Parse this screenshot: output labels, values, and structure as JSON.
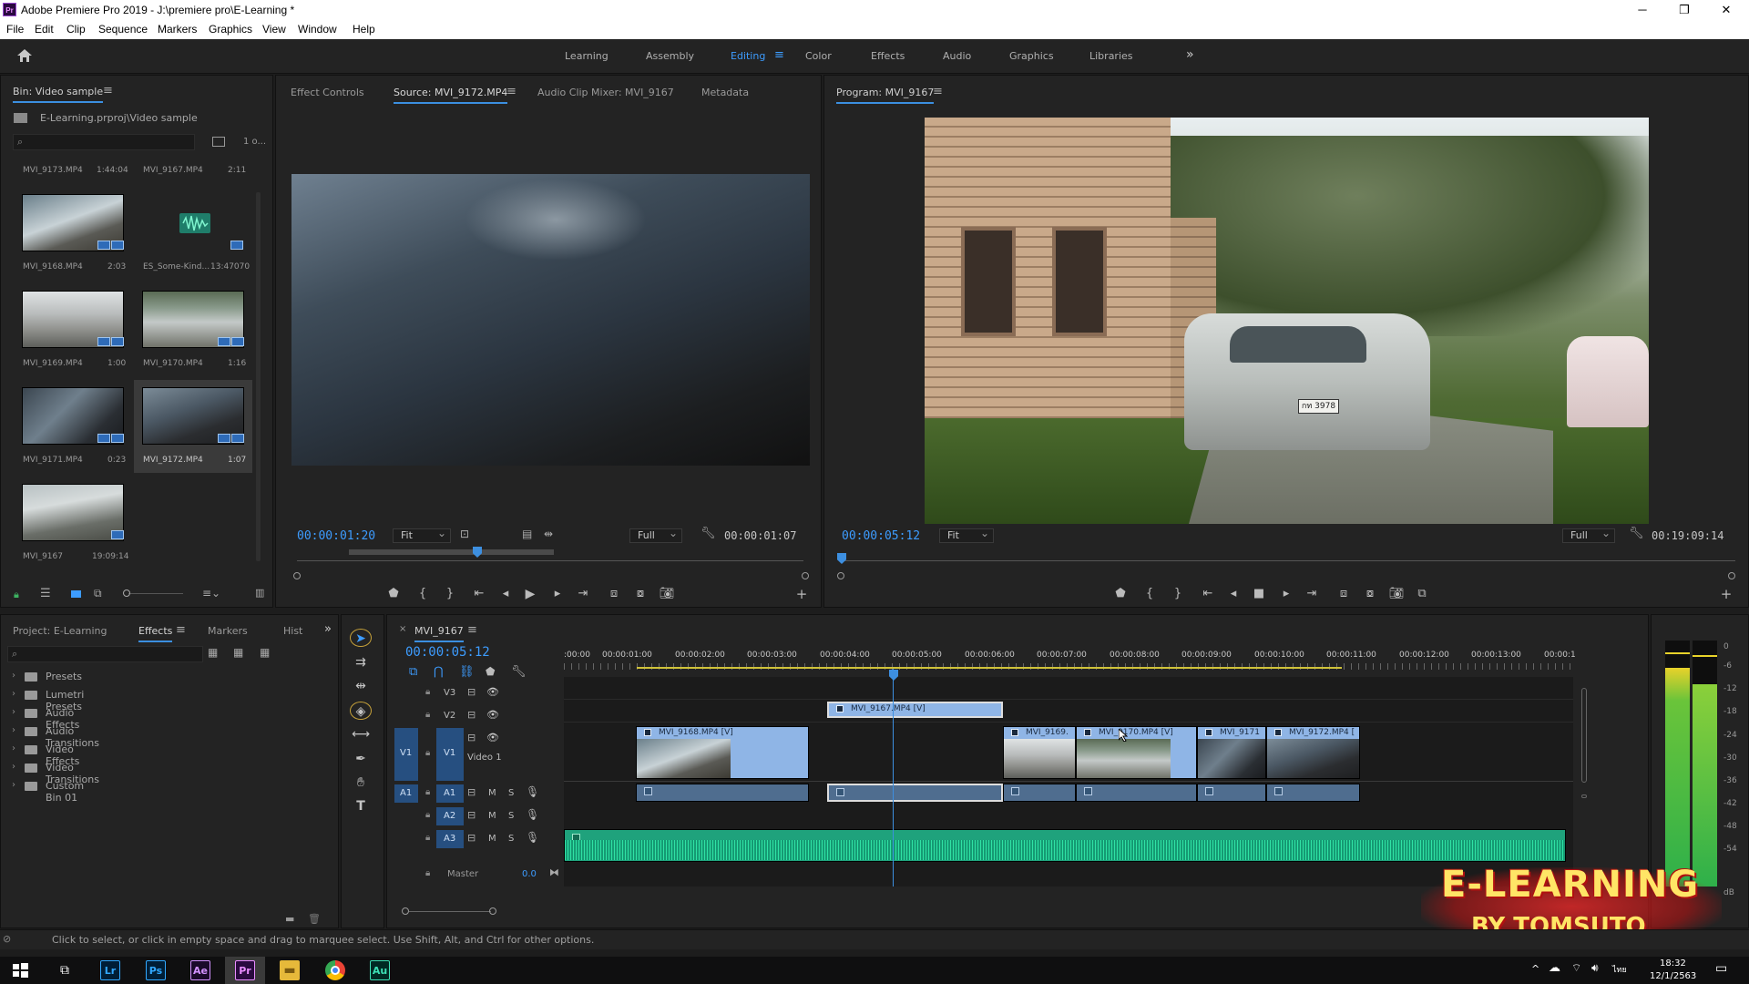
{
  "app": {
    "title": "Adobe Premiere Pro 2019 - J:\\premiere pro\\E-Learning *",
    "icon_text": "Pr"
  },
  "menu": [
    "File",
    "Edit",
    "Clip",
    "Sequence",
    "Markers",
    "Graphics",
    "View",
    "Window",
    "Help"
  ],
  "workspaces": {
    "items": [
      "Learning",
      "Assembly",
      "Editing",
      "Color",
      "Effects",
      "Audio",
      "Graphics",
      "Libraries"
    ],
    "active": "Editing"
  },
  "bin": {
    "tab": "Bin: Video sample",
    "path": "E-Learning.prproj\\Video sample",
    "search_placeholder": "",
    "count": "1 o...",
    "clips": [
      {
        "name": "MVI_9173.MP4",
        "dur": "1:44:04"
      },
      {
        "name": "MVI_9167.MP4",
        "dur": "2:11"
      },
      {
        "name": "MVI_9168.MP4",
        "dur": "2:03"
      },
      {
        "name": "ES_Some-Kind...",
        "dur": "13:47070"
      },
      {
        "name": "MVI_9169.MP4",
        "dur": "1:00"
      },
      {
        "name": "MVI_9170.MP4",
        "dur": "1:16"
      },
      {
        "name": "MVI_9171.MP4",
        "dur": "0:23"
      },
      {
        "name": "MVI_9172.MP4",
        "dur": "1:07"
      },
      {
        "name": "MVI_9167",
        "dur": "19:09:14"
      }
    ]
  },
  "source": {
    "tabs": [
      "Effect Controls",
      "Source: MVI_9172.MP4",
      "Audio Clip Mixer: MVI_9167",
      "Metadata"
    ],
    "active_tab": "Source: MVI_9172.MP4",
    "timecode": "00:00:01:20",
    "fit": "Fit",
    "quality": "Full",
    "duration": "00:00:01:07"
  },
  "program": {
    "tab": "Program: MVI_9167",
    "timecode": "00:00:05:12",
    "fit": "Fit",
    "quality": "Full",
    "duration": "00:19:09:14",
    "plate": "กท 3978"
  },
  "project": {
    "tabs": [
      "Project: E-Learning",
      "Effects",
      "Markers",
      "Hist"
    ],
    "active_tab": "Effects",
    "tree": [
      "Presets",
      "Lumetri Presets",
      "Audio Effects",
      "Audio Transitions",
      "Video Effects",
      "Video Transitions",
      "Custom Bin 01"
    ]
  },
  "timeline": {
    "tab": "MVI_9167",
    "timecode": "00:00:05:12",
    "ruler": [
      ":00:00",
      "00:00:01:00",
      "00:00:02:00",
      "00:00:03:00",
      "00:00:04:00",
      "00:00:05:00",
      "00:00:06:00",
      "00:00:07:00",
      "00:00:08:00",
      "00:00:09:00",
      "00:00:10:00",
      "00:00:11:00",
      "00:00:12:00",
      "00:00:13:00",
      "00:00:1"
    ],
    "tracks": {
      "v3": "V3",
      "v2": "V2",
      "v1": "V1",
      "v1_source": "V1",
      "v1_name": "Video 1",
      "a1": "A1",
      "a1_source": "A1",
      "a2": "A2",
      "a3": "A3",
      "master": "Master",
      "master_val": "0.0",
      "m": "M",
      "s": "S"
    },
    "clips": {
      "v2": "MVI_9167.MP4 [V]",
      "v1a": "MVI_9168.MP4 [V]",
      "v1b": "MVI_9169.",
      "v1c": "MVI_9170.MP4 [V]",
      "v1d": "MVI_9171",
      "v1e": "MVI_9172.MP4 ["
    }
  },
  "meter": {
    "ticks": [
      "0",
      "-6",
      "-12",
      "-18",
      "-24",
      "-30",
      "-36",
      "-42",
      "-48",
      "-54",
      "dB"
    ]
  },
  "status": "Click to select, or click in empty space and drag to marquee select. Use Shift, Alt, and Ctrl for other options.",
  "watermark": {
    "line1": "E-LEARNING",
    "line2": "BY TOMSUTO"
  },
  "taskbar": {
    "apps": [
      "Lr",
      "Ps",
      "Ae",
      "Pr",
      "Au"
    ],
    "time": "18:32",
    "date": "12/1/2563",
    "lang": "ไทย"
  }
}
